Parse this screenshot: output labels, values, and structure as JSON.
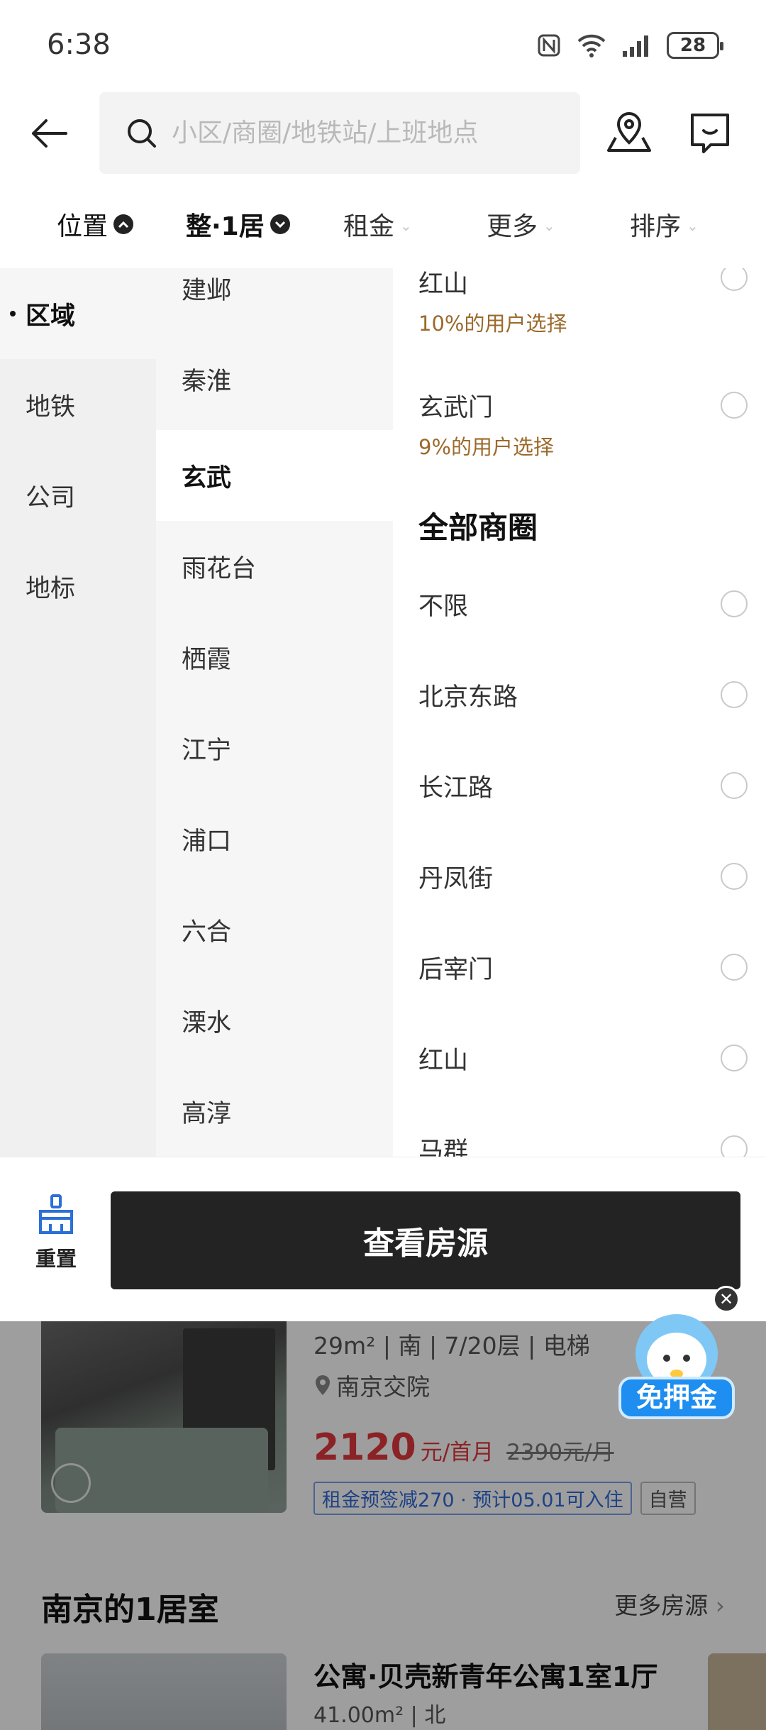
{
  "status_bar": {
    "time": "6:38",
    "battery": "28"
  },
  "search": {
    "placeholder": "小区/商圈/地铁站/上班地点"
  },
  "filters": [
    {
      "label": "位置"
    },
    {
      "label": "整·1居"
    },
    {
      "label": "租金"
    },
    {
      "label": "更多"
    },
    {
      "label": "排序"
    }
  ],
  "location_types": [
    "区域",
    "地铁",
    "公司",
    "地标"
  ],
  "districts": [
    "建邺",
    "秦淮",
    "玄武",
    "雨花台",
    "栖霞",
    "江宁",
    "浦口",
    "六合",
    "溧水",
    "高淳"
  ],
  "popular": [
    {
      "name": "红山",
      "sub": "10%的用户选择"
    },
    {
      "name": "玄武门",
      "sub": "9%的用户选择"
    }
  ],
  "all_heading": "全部商圈",
  "business_areas": [
    "不限",
    "北京东路",
    "长江路",
    "丹凤街",
    "后宰门",
    "红山",
    "马群"
  ],
  "actions": {
    "reset": "重置",
    "view": "查看房源"
  },
  "listing": {
    "meta": "29m² | 南 | 7/20层 | 电梯",
    "location": "南京交院",
    "price": "2120",
    "price_unit": "元/首月",
    "old_price": "2390元/月",
    "tag1": "租金预签减270 · 预计05.01可入住",
    "tag2": "自营"
  },
  "section": {
    "title": "南京的1居室",
    "more": "更多房源"
  },
  "listing2": {
    "title": "公寓·贝壳新青年公寓1室1厅",
    "meta": "41.00m² | 北"
  },
  "promo": {
    "label": "免押金"
  },
  "colors": {
    "accent_price": "#e0383e",
    "popular_sub": "#9b6a2c",
    "button_dark": "#232323",
    "tag_blue": "#2f6ad8"
  }
}
